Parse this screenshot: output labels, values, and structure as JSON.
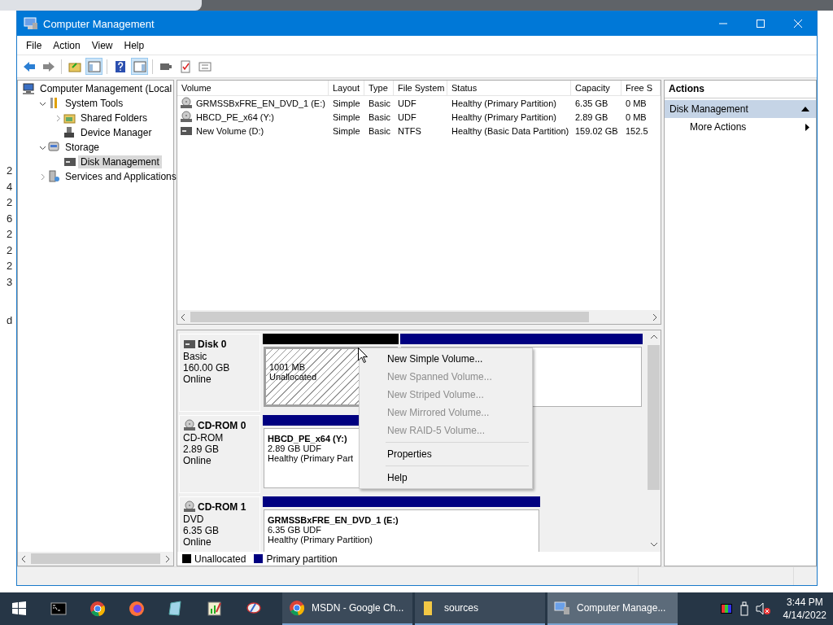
{
  "background": {
    "fragments": [
      "2",
      "4",
      "2",
      "6",
      "2",
      "2",
      "2",
      "3",
      "d"
    ]
  },
  "window": {
    "title": "Computer Management"
  },
  "menu_bar": [
    "File",
    "Action",
    "View",
    "Help"
  ],
  "tree": [
    {
      "kind": "computer",
      "label": "Computer Management (Local",
      "selected": false,
      "children": [
        {
          "kind": "tools",
          "label": "System Tools",
          "selected": false,
          "expanded": true,
          "children": [
            {
              "kind": "shared",
              "label": "Shared Folders",
              "selected": false,
              "expanded": false
            },
            {
              "kind": "device",
              "label": "Device Manager",
              "selected": false
            }
          ]
        },
        {
          "kind": "storage",
          "label": "Storage",
          "selected": false,
          "expanded": true,
          "children": [
            {
              "kind": "disk",
              "label": "Disk Management",
              "selected": true
            }
          ]
        },
        {
          "kind": "services",
          "label": "Services and Applications",
          "selected": false,
          "expanded": false
        }
      ]
    }
  ],
  "volume_list": {
    "columns": [
      "Volume",
      "Layout",
      "Type",
      "File System",
      "Status",
      "Capacity",
      "Free S"
    ],
    "rows": [
      {
        "kind": "cd",
        "cells": [
          "GRMSSBxFRE_EN_DVD_1 (E:)",
          "Simple",
          "Basic",
          "UDF",
          "Healthy (Primary Partition)",
          "6.35 GB",
          "0 MB"
        ]
      },
      {
        "kind": "cd",
        "cells": [
          "HBCD_PE_x64 (Y:)",
          "Simple",
          "Basic",
          "UDF",
          "Healthy (Primary Partition)",
          "2.89 GB",
          "0 MB"
        ]
      },
      {
        "kind": "hdd",
        "cells": [
          "New Volume (D:)",
          "Simple",
          "Basic",
          "NTFS",
          "Healthy (Basic Data Partition)",
          "159.02 GB",
          "152.5"
        ]
      }
    ]
  },
  "disks": [
    {
      "kind": "hdd",
      "name": "Disk 0",
      "type": "Basic",
      "size": "160.00 GB",
      "status": "Online",
      "partitions": [
        {
          "kind": "unallocated",
          "level": 0.36,
          "selected": true,
          "lines": [
            "1001 MB",
            "Unallocated"
          ]
        },
        {
          "kind": "primary",
          "level": 0.64,
          "selected": false
        }
      ]
    },
    {
      "kind": "cd",
      "name": "CD-ROM 0",
      "type": "CD-ROM",
      "size": "2.89 GB",
      "status": "Online",
      "partitions": [
        {
          "kind": "primary",
          "level": 0.67,
          "selected": false,
          "label": "HBCD_PE_x64  (Y:)",
          "lines": [
            "2.89 GB UDF",
            "Healthy (Primary Part"
          ]
        }
      ]
    },
    {
      "kind": "cd",
      "name": "CD-ROM 1",
      "type": "DVD",
      "size": "6.35 GB",
      "status": "Online",
      "partitions": [
        {
          "kind": "primary",
          "level": 0.73,
          "selected": false,
          "label": "GRMSSBxFRE_EN_DVD_1  (E:)",
          "lines": [
            "6.35 GB UDF",
            "Healthy (Primary Partition)"
          ]
        }
      ]
    }
  ],
  "legend": [
    {
      "label": "Unallocated",
      "color": "#000000"
    },
    {
      "label": "Primary partition",
      "color": "#000080"
    }
  ],
  "actions": {
    "title": "Actions",
    "section": {
      "label": "Disk Management",
      "expanded": true
    },
    "items": [
      "More Actions"
    ]
  },
  "context_menu": [
    {
      "kind": "item",
      "label": "New Simple Volume...",
      "disabled": false
    },
    {
      "kind": "item",
      "label": "New Spanned Volume...",
      "disabled": true
    },
    {
      "kind": "item",
      "label": "New Striped Volume...",
      "disabled": true
    },
    {
      "kind": "item",
      "label": "New Mirrored Volume...",
      "disabled": true
    },
    {
      "kind": "item",
      "label": "New RAID-5 Volume...",
      "disabled": true
    },
    {
      "kind": "separator"
    },
    {
      "kind": "item",
      "label": "Properties",
      "disabled": false
    },
    {
      "kind": "separator"
    },
    {
      "kind": "item",
      "label": "Help",
      "disabled": false
    }
  ],
  "taskbar": {
    "windows": [
      {
        "kind": "chrome",
        "label": "MSDN - Google Ch...",
        "selected": false
      },
      {
        "kind": "folder",
        "label": "sources",
        "selected": false
      },
      {
        "kind": "mmc",
        "label": "Computer Manage...",
        "selected": true
      }
    ],
    "time": "3:44 PM",
    "date": "4/14/2022"
  }
}
